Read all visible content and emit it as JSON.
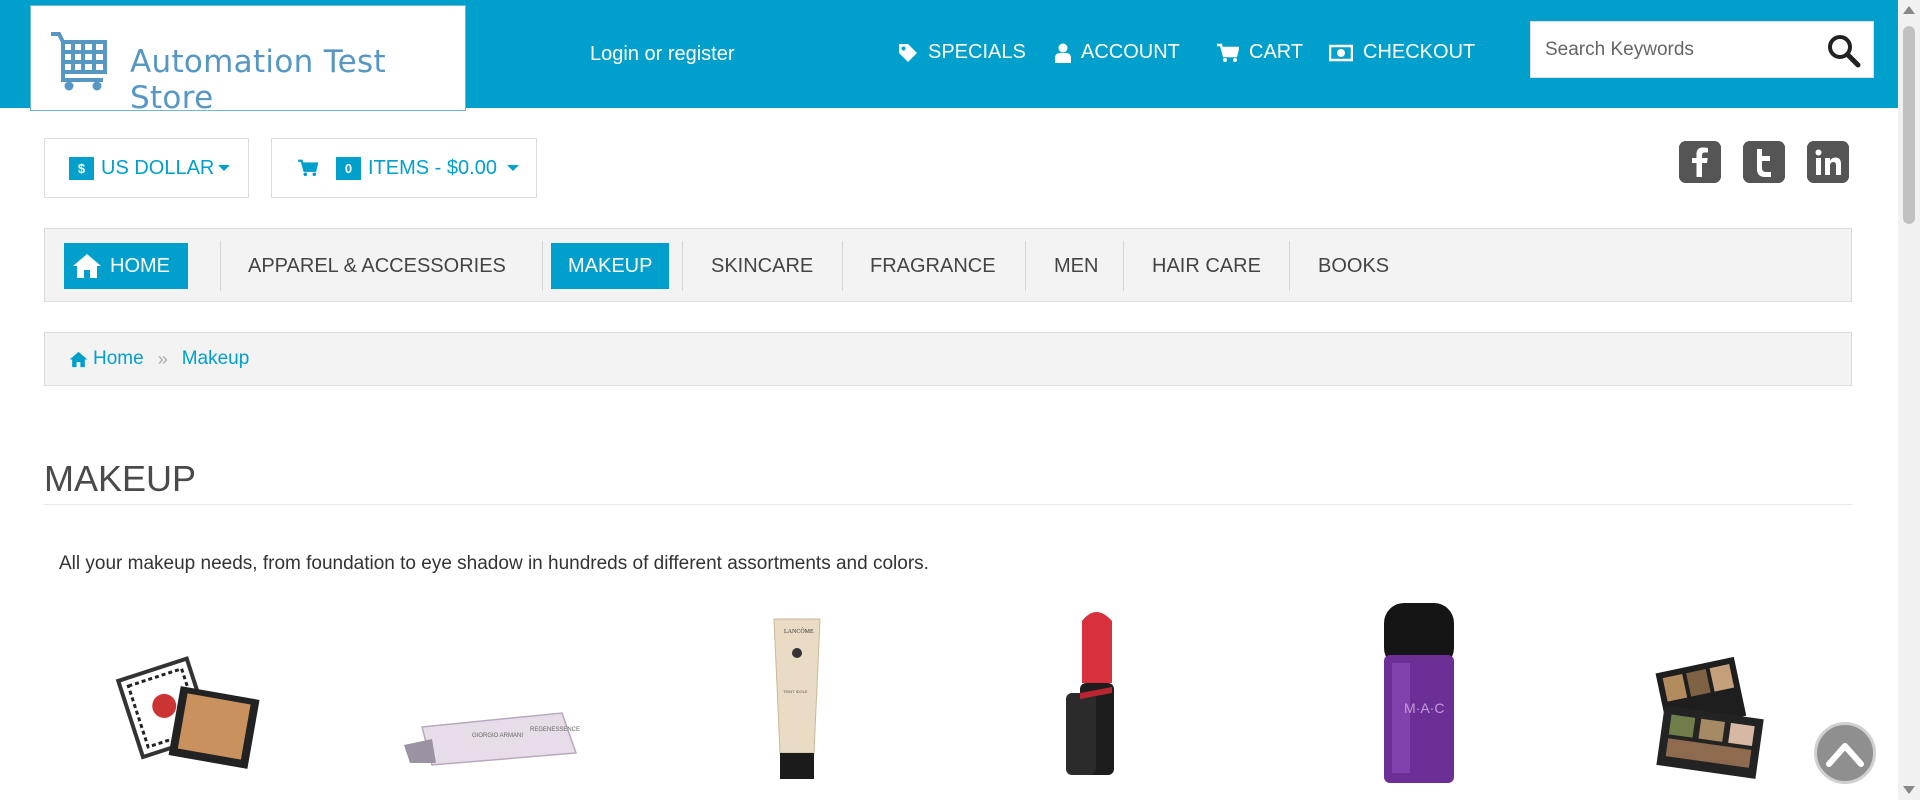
{
  "header": {
    "store_name": "Automation Test Store",
    "login_text": "Login or register",
    "nav": [
      {
        "label": "SPECIALS",
        "icon": "tag-icon"
      },
      {
        "label": "ACCOUNT",
        "icon": "user-icon"
      },
      {
        "label": "CART",
        "icon": "cart-icon"
      },
      {
        "label": "CHECKOUT",
        "icon": "money-icon"
      }
    ],
    "search_placeholder": "Search Keywords"
  },
  "currency": {
    "symbol": "$",
    "label": "US DOLLAR"
  },
  "mini_cart": {
    "count": "0",
    "label": "ITEMS - $0.00"
  },
  "social": [
    "facebook-icon",
    "twitter-icon",
    "linkedin-icon"
  ],
  "menu": [
    {
      "label": "HOME"
    },
    {
      "label": "APPAREL & ACCESSORIES"
    },
    {
      "label": "MAKEUP"
    },
    {
      "label": "SKINCARE"
    },
    {
      "label": "FRAGRANCE"
    },
    {
      "label": "MEN"
    },
    {
      "label": "HAIR CARE"
    },
    {
      "label": "BOOKS"
    }
  ],
  "breadcrumb": {
    "home": "Home",
    "current": "Makeup"
  },
  "page": {
    "title": "MAKEUP",
    "description": "All your makeup needs, from foundation to eye shadow in hundreds of different assortments and colors."
  },
  "products": [
    {
      "name": "compact-powder-image"
    },
    {
      "name": "eye-cream-tube-image"
    },
    {
      "name": "foundation-tube-image"
    },
    {
      "name": "lipstick-image"
    },
    {
      "name": "nail-polish-image"
    },
    {
      "name": "eyeshadow-palette-image"
    }
  ],
  "colors": {
    "brand": "#009fcc",
    "menu_bg": "#f3f3f3",
    "text": "#444444"
  }
}
